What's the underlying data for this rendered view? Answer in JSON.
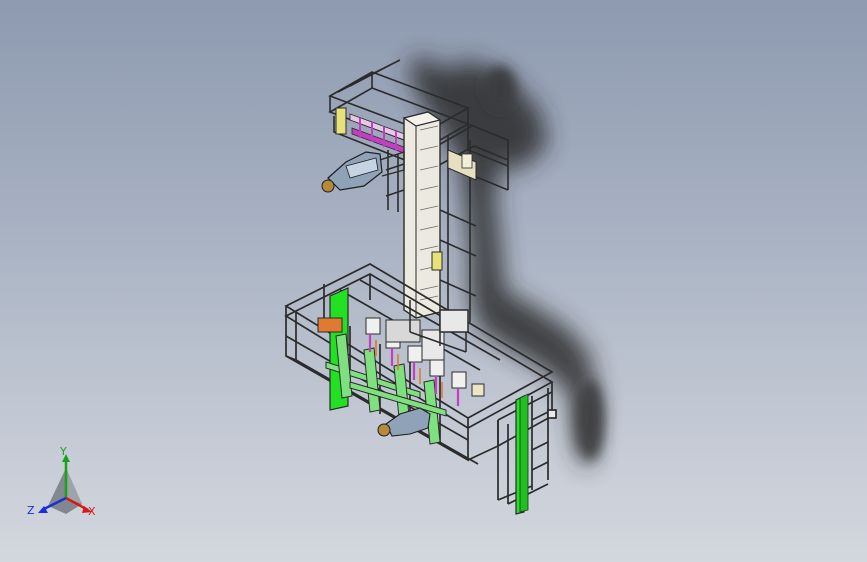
{
  "viewport": {
    "background_top": "#8e9ab0",
    "background_bottom": "#d3d7de"
  },
  "model": {
    "frame_color": "#2b2b2b",
    "frame_fill": "#b9bec6",
    "panel_green": "#22e022",
    "brace_green": "#7fe07f",
    "accent_yellow": "#e6e27a",
    "accent_orange": "#e07a30",
    "accent_magenta": "#c040c0",
    "shadow_color": "#2a2a2a"
  },
  "triad": {
    "x_label": "X",
    "y_label": "Y",
    "z_label": "Z",
    "x_color": "#d51a1a",
    "y_color": "#1aa31a",
    "z_color": "#1a2fd8"
  }
}
